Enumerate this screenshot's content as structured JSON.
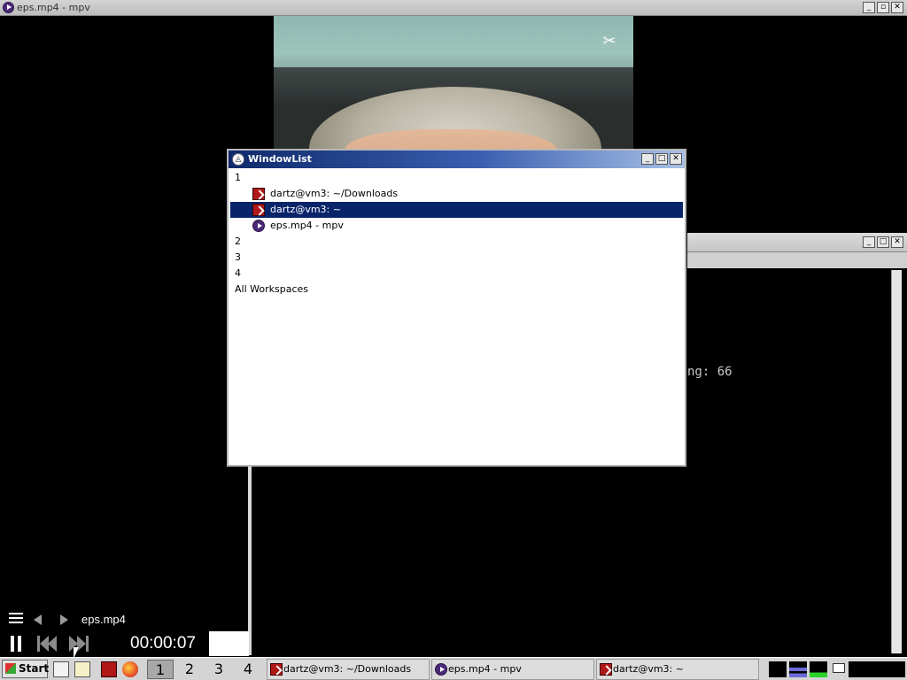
{
  "mpv_window": {
    "title": "eps.mp4 - mpv",
    "buttons": {
      "minimize": "_",
      "maximize": "▫",
      "close": "✕"
    }
  },
  "video": {
    "logo_icon": "capcut-logo-icon"
  },
  "terminal_window": {
    "visible_text": "ng: 66",
    "buttons": {
      "minimize": "_",
      "maximize": "□",
      "close": "✕"
    }
  },
  "window_list": {
    "title": "WindowList",
    "buttons": {
      "minimize": "_",
      "maximize": "□",
      "close": "✕"
    },
    "rows": [
      {
        "type": "workspace",
        "label": "1"
      },
      {
        "type": "window",
        "label": "dartz@vm3: ~/Downloads",
        "icon": "terminal-icon",
        "selected": false
      },
      {
        "type": "window",
        "label": "dartz@vm3: ~",
        "icon": "terminal-icon",
        "selected": true
      },
      {
        "type": "window",
        "label": "eps.mp4 - mpv",
        "icon": "mpv-icon",
        "selected": false
      },
      {
        "type": "workspace",
        "label": "2"
      },
      {
        "type": "workspace",
        "label": "3"
      },
      {
        "type": "workspace",
        "label": "4"
      },
      {
        "type": "workspace",
        "label": "All Workspaces"
      }
    ]
  },
  "osc": {
    "filename": "eps.mp4",
    "time": "00:00:07",
    "icons": [
      "menu-icon",
      "prev-icon",
      "next-icon",
      "pause-icon",
      "skip-back-icon",
      "skip-forward-icon"
    ]
  },
  "taskbar": {
    "start_label": "Start",
    "workspaces": [
      "1",
      "2",
      "3",
      "4"
    ],
    "active_workspace": "1",
    "tasks": [
      {
        "label": "dartz@vm3: ~/Downloads",
        "icon": "terminal-icon"
      },
      {
        "label": "eps.mp4 - mpv",
        "icon": "mpv-icon"
      },
      {
        "label": "dartz@vm3: ~",
        "icon": "terminal-icon"
      }
    ],
    "launchers": [
      "file-manager-icon",
      "notes-icon",
      "terminal-icon",
      "firefox-icon"
    ],
    "tray_icons": [
      "cpu-monitor-icon",
      "network-icon",
      "memory-icon",
      "mail-icon"
    ]
  },
  "colors": {
    "selection": "#0a246a",
    "titlebar_active_start": "#0e2a6b",
    "titlebar_active_end": "#a9c1e6",
    "terminal_red": "#b01818",
    "mpv_purple": "#4b2a78"
  }
}
